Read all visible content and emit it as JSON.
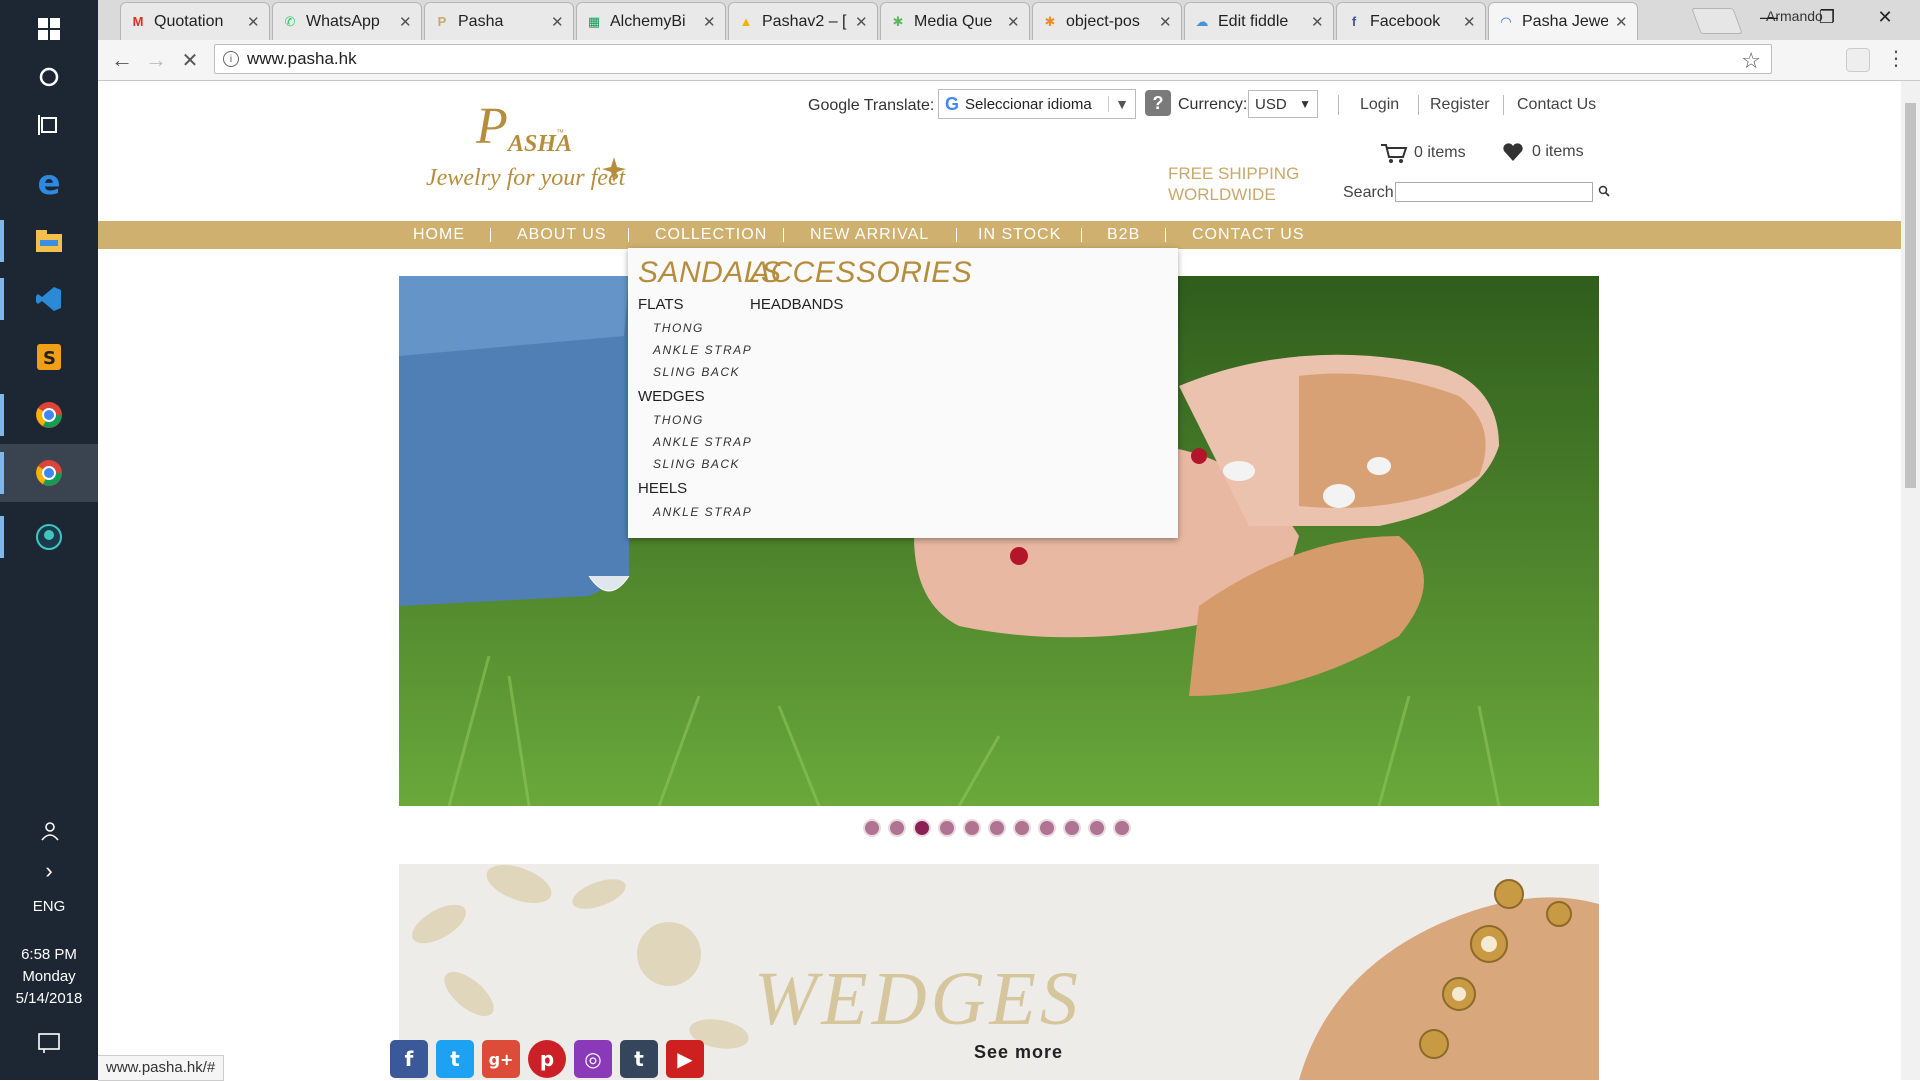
{
  "taskbar": {
    "language": "ENG",
    "clock_time": "6:58 PM",
    "clock_day": "Monday",
    "clock_date": "5/14/2018"
  },
  "tabs": [
    {
      "label": "Quotation",
      "icon": "gmail-icon",
      "fav": "M",
      "color": "#d93025"
    },
    {
      "label": "WhatsApp",
      "icon": "whatsapp-icon",
      "fav": "✆",
      "color": "#25d366"
    },
    {
      "label": "Pasha",
      "icon": "pasha-icon",
      "fav": "P",
      "color": "#c8a96b"
    },
    {
      "label": "AlchemyBi",
      "icon": "sheets-icon",
      "fav": "▦",
      "color": "#0f9d58"
    },
    {
      "label": "Pashav2 – [",
      "icon": "drive-icon",
      "fav": "▲",
      "color": "#f4b400"
    },
    {
      "label": "Media Que",
      "icon": "media-icon",
      "fav": "✱",
      "color": "#5cb85c"
    },
    {
      "label": "object-pos",
      "icon": "codepen-icon",
      "fav": "✱",
      "color": "#f08c1a"
    },
    {
      "label": "Edit fiddle",
      "icon": "fiddle-icon",
      "fav": "☁",
      "color": "#4a90d9"
    },
    {
      "label": "Facebook",
      "icon": "facebook-icon",
      "fav": "f",
      "color": "#3b5998"
    },
    {
      "label": "Pasha Jewe",
      "icon": "loading-icon",
      "fav": "◠",
      "color": "#1a73e8"
    }
  ],
  "browser": {
    "profile_name": "Armando",
    "url": "www.pasha.hk",
    "status_url": "www.pasha.hk/#"
  },
  "header": {
    "logo_text": "PASHA",
    "logo_tagline": "Jewelry for your feet",
    "translate_label": "Google Translate:",
    "translate_value": "Seleccionar idioma",
    "currency_label": "Currency:",
    "currency_value": "USD",
    "links": [
      "Login",
      "Register",
      "Contact Us"
    ],
    "free_shipping_1": "FREE SHIPPING",
    "free_shipping_2": "WORLDWIDE",
    "cart_count": "0 items",
    "wishlist_count": "0 items",
    "search_label": "Search"
  },
  "nav": [
    "HOME",
    "ABOUT US",
    "COLLECTION",
    "NEW ARRIVAL",
    "IN STOCK",
    "B2B",
    "CONTACT US"
  ],
  "dropdown": {
    "sandals_title": "SANDALS",
    "accessories_title": "ACCESSORIES",
    "flats": "FLATS",
    "flats_items": [
      "THONG",
      "ANKLE STRAP",
      "SLING BACK"
    ],
    "wedges": "WEDGES",
    "wedges_items": [
      "THONG",
      "ANKLE STRAP",
      "SLING BACK"
    ],
    "heels": "HEELS",
    "heels_items": [
      "ANKLE STRAP"
    ],
    "headbands": "HEADBANDS"
  },
  "slider": {
    "total_slides": 11,
    "active_slide": 3
  },
  "banner": {
    "title": "WEDGES",
    "cta": "See more"
  },
  "colors": {
    "brand_gold": "#cfb06e",
    "accent_text": "#b58d3c",
    "dot_active": "#8b1f56"
  }
}
